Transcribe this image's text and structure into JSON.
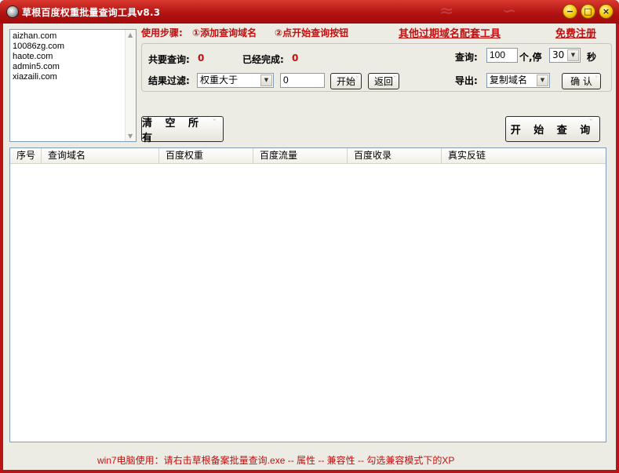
{
  "window": {
    "title": "草根百度权重批量查询工具v8.3",
    "controls": {
      "minimize": "−",
      "maximize": "□",
      "close": "×"
    },
    "colors": {
      "frame": "#b81414",
      "accent_text": "#c01010",
      "control_button": "#f5c400"
    }
  },
  "domains": [
    "aizhan.com",
    "10086zg.com",
    "haote.com",
    "admin5.com",
    "xiazaili.com"
  ],
  "steps": {
    "label": "使用步骤:",
    "step1": "①添加查询域名",
    "step2": "②点开始查询按钮"
  },
  "links": {
    "other_tools": "其他过期域名配套工具",
    "register": "免费注册"
  },
  "stats": {
    "total_label": "共要查询:",
    "total_value": "0",
    "done_label": "已经完成:",
    "done_value": "0"
  },
  "query": {
    "label": "查询:",
    "count": "100",
    "count_suffix": "个,停",
    "pause": "30",
    "pause_suffix": "秒"
  },
  "filter": {
    "label": "结果过滤:",
    "selected": "权重大于",
    "value": "0",
    "start_button": "开始",
    "back_button": "返回"
  },
  "export": {
    "label": "导出:",
    "selected": "复制域名",
    "confirm_button": "确 认"
  },
  "buttons": {
    "clear_all": "清 空 所 有",
    "start_query": "开 始 查 询"
  },
  "table": {
    "columns": [
      "序号",
      "查询域名",
      "百度权重",
      "百度流量",
      "百度收录",
      "真实反链"
    ],
    "rows": []
  },
  "footer": {
    "note": "win7电脑使用：请右击草根备案批量查询.exe -- 属性 -- 兼容性 -- 勾选兼容模式下的XP"
  }
}
